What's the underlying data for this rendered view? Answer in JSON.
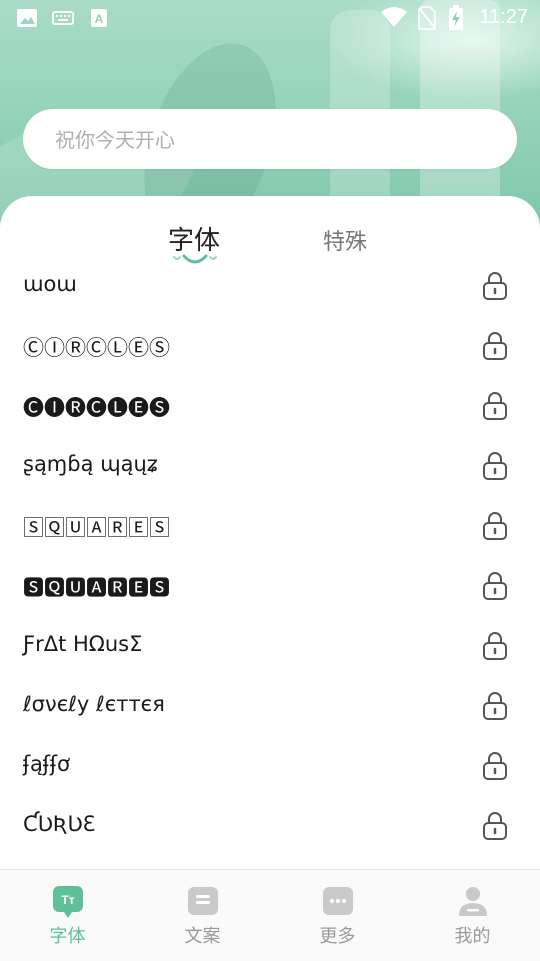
{
  "status_bar": {
    "time": "11:27",
    "icons": [
      "image-icon",
      "keyboard-icon",
      "a-text-icon",
      "wifi-icon",
      "no-sim-icon",
      "battery-charging-icon"
    ]
  },
  "search": {
    "placeholder": "祝你今天开心"
  },
  "tabs": [
    {
      "label": "字体",
      "active": true
    },
    {
      "label": "特殊",
      "active": false
    }
  ],
  "font_list": [
    {
      "label": "ɯoɯ",
      "locked": true
    },
    {
      "label": "ⒸⒾⓇⒸⓁⒺⓈ",
      "locked": true
    },
    {
      "label": "🅒🅘🅡🅒🅛🅔🅢",
      "locked": true
    },
    {
      "label": "ʂąɱɓą ɰąųʑ",
      "locked": true
    },
    {
      "label": "🅂🅀🅄🄰🅁🄴🅂",
      "locked": true
    },
    {
      "label": "🆂🆀🆄🅰🆁🅴🆂",
      "locked": true
    },
    {
      "label": "ƑrΔt HΩusΣ",
      "locked": true
    },
    {
      "label": "ℓσνєℓу ℓєттєя",
      "locked": true
    },
    {
      "label": "ʄąʄʄơ",
      "locked": true
    },
    {
      "label": "ƇƲƦƲƐ",
      "locked": true
    }
  ],
  "bottom_nav": [
    {
      "label": "字体",
      "icon": "font-tt-icon",
      "active": true
    },
    {
      "label": "文案",
      "icon": "document-icon",
      "active": false
    },
    {
      "label": "更多",
      "icon": "chat-more-icon",
      "active": false
    },
    {
      "label": "我的",
      "icon": "user-icon",
      "active": false
    }
  ],
  "colors": {
    "accent": "#5fbf98",
    "hero": "#8fd0b6",
    "inactive": "#9a9a9a"
  }
}
